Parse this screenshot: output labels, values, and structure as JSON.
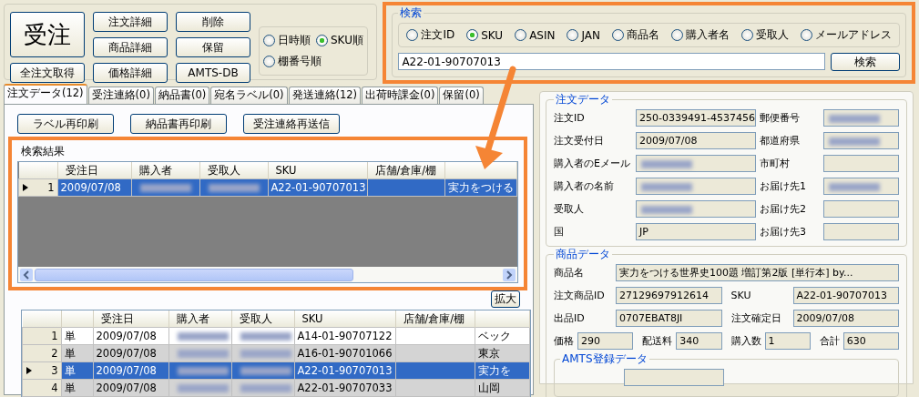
{
  "toolbar": {
    "main_button": "受注",
    "fetch_button": "全注文取得",
    "buttons": [
      "注文詳細",
      "削除",
      "商品詳細",
      "保留",
      "価格詳細",
      "AMTS-DB"
    ],
    "sort_options": [
      {
        "label": "日時順",
        "selected": false
      },
      {
        "label": "SKU順",
        "selected": true
      },
      {
        "label": "棚番号順",
        "selected": false
      }
    ]
  },
  "search": {
    "title": "検索",
    "options": [
      {
        "label": "注文ID",
        "selected": false
      },
      {
        "label": "SKU",
        "selected": true
      },
      {
        "label": "ASIN",
        "selected": false
      },
      {
        "label": "JAN",
        "selected": false
      },
      {
        "label": "商品名",
        "selected": false
      },
      {
        "label": "購入者名",
        "selected": false
      },
      {
        "label": "受取人",
        "selected": false
      },
      {
        "label": "メールアドレス",
        "selected": false
      }
    ],
    "value": "A22-01-90707013",
    "button": "検索"
  },
  "tabs": [
    {
      "label": "注文データ(12)",
      "selected": true
    },
    {
      "label": "受注連絡(0)",
      "selected": false
    },
    {
      "label": "納品書(0)",
      "selected": false
    },
    {
      "label": "宛名ラベル(0)",
      "selected": false
    },
    {
      "label": "発送連絡(12)",
      "selected": false
    },
    {
      "label": "出荷時課金(0)",
      "selected": false
    },
    {
      "label": "保留(0)",
      "selected": false
    }
  ],
  "actions": [
    "ラベル再印刷",
    "納品書再印刷",
    "受注連絡再送信"
  ],
  "search_results": {
    "title": "検索結果",
    "columns": [
      "受注日",
      "購入者",
      "受取人",
      "SKU",
      "店舗/倉庫/棚",
      ""
    ],
    "rows": [
      {
        "number": "1",
        "current": true,
        "selected": true,
        "cells": [
          "2009/07/08",
          {
            "blurred": true
          },
          {
            "blurred": true
          },
          "A22-01-90707013",
          "",
          "実力をつける"
        ]
      }
    ]
  },
  "expand_button": "拡大",
  "orders": {
    "columns": [
      "",
      "受注日",
      "購入者",
      "受取人",
      "SKU",
      "店舗/倉庫/棚",
      ""
    ],
    "rows": [
      {
        "number": "1",
        "current": false,
        "selected": false,
        "cells": [
          "単",
          "2009/07/08",
          {
            "blurred": true
          },
          {
            "blurred": true
          },
          "A14-01-90707122",
          "",
          "ベック"
        ]
      },
      {
        "number": "2",
        "current": false,
        "selected": false,
        "cells": [
          "単",
          "2009/07/08",
          {
            "blurred": true
          },
          {
            "blurred": true
          },
          "A16-01-90701066",
          "",
          "東京"
        ]
      },
      {
        "number": "3",
        "current": true,
        "selected": true,
        "cells": [
          "単",
          "2009/07/08",
          {
            "blurred": true
          },
          {
            "blurred": true
          },
          "A22-01-90707013",
          "",
          "実力を"
        ]
      },
      {
        "number": "4",
        "current": false,
        "selected": false,
        "cells": [
          "単",
          "2009/07/08",
          {
            "blurred": true
          },
          {
            "blurred": true
          },
          "A22-01-90707033",
          "",
          "山岡"
        ]
      }
    ]
  },
  "order_data": {
    "title": "注文データ",
    "fields": [
      {
        "label": "注文ID",
        "value": "250-0339491-4537456",
        "blurred": false
      },
      {
        "label": "郵便番号",
        "blurred": true
      },
      {
        "label": "注文受付日",
        "value": "2009/07/08",
        "blurred": false
      },
      {
        "label": "都道府県",
        "blurred": true
      },
      {
        "label": "購入者のEメール",
        "blurred": true
      },
      {
        "label": "市町村",
        "blurred": false
      },
      {
        "label": "購入者の名前",
        "blurred": true
      },
      {
        "label": "お届け先1",
        "blurred": true
      },
      {
        "label": "受取人",
        "blurred": true
      },
      {
        "label": "お届け先2",
        "blurred": false
      },
      {
        "label": "国",
        "value": "JP",
        "blurred": false
      },
      {
        "label": "お届け先3",
        "blurred": false
      }
    ]
  },
  "product_data": {
    "title": "商品データ",
    "fields": [
      {
        "kind": "wide",
        "label": "商品名",
        "value": "実力をつける世界史100題 増訂第2版 [単行本] by..."
      },
      {
        "kind": "half",
        "label": "注文商品ID",
        "value": "27129697912614"
      },
      {
        "kind": "half",
        "label": "SKU",
        "value": "A22-01-90707013"
      },
      {
        "kind": "half",
        "label": "出品ID",
        "value": "0707EBAT8JI"
      },
      {
        "kind": "half",
        "label": "注文確定日",
        "value": "2009/07/08"
      },
      {
        "kind": "small",
        "label": "価格",
        "value": "290"
      },
      {
        "kind": "small",
        "label": "配送料",
        "value": "340"
      },
      {
        "kind": "small",
        "label": "購入数",
        "value": "1"
      },
      {
        "kind": "small",
        "label": "合計",
        "value": "630"
      }
    ]
  },
  "amts_data": {
    "title": "AMTS登録データ"
  }
}
